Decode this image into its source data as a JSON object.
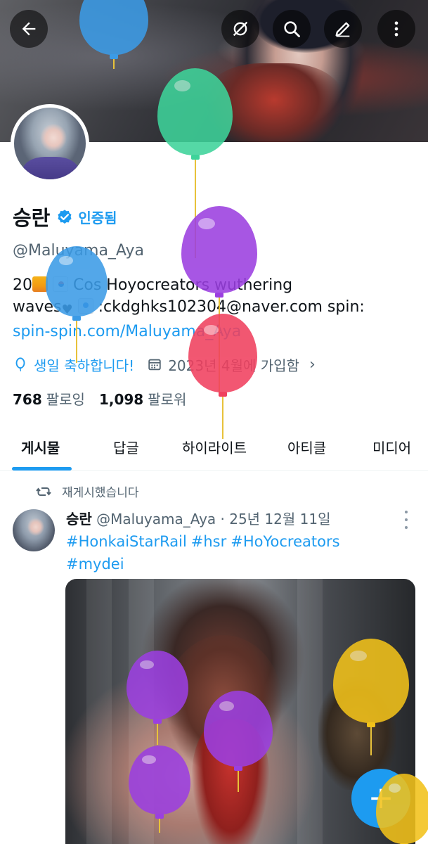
{
  "header": {
    "back_icon": "arrow-left-icon",
    "actions": [
      "no-sync-icon",
      "search-icon",
      "edit-pencil-icon",
      "more-vertical-icon"
    ]
  },
  "profile": {
    "display_name": "승란",
    "verified_label": "인증됨",
    "handle": "@Maluyama_Aya",
    "bio": {
      "l1_a": "20",
      "l1_b": "Cos Hoyocreators wuthering",
      "l2_a": "waves",
      "l2_b": ":ckdghks102304@naver.com spin:",
      "l3_link": "spin-spin.com/Maluyama_Aya"
    },
    "birthday": "생일 축하합니다!",
    "joined": "2023년 4월에 가입함",
    "following_count": "768",
    "following_label": "팔로잉",
    "followers_count": "1,098",
    "followers_label": "팔로워"
  },
  "tabs": [
    "게시물",
    "답글",
    "하이라이트",
    "아티클",
    "미디어"
  ],
  "post": {
    "repost_label": "재게시했습니다",
    "author_name": "승란",
    "author_meta": "@Maluyama_Aya · 25년 12월 11일",
    "hashtags": [
      "#HonkaiStarRail",
      "#hsr",
      "#HoYocreators",
      "#mydei"
    ]
  },
  "fab_label": "+",
  "colors": {
    "accent": "#1d9bf0",
    "text": "#0f1419",
    "secondary_text": "#536471",
    "balloon_blue": "#3b9be6",
    "balloon_green": "#3ed39a",
    "balloon_purple": "#9b3fe0",
    "balloon_red": "#f0405e",
    "balloon_yellow": "#f2c21a"
  }
}
